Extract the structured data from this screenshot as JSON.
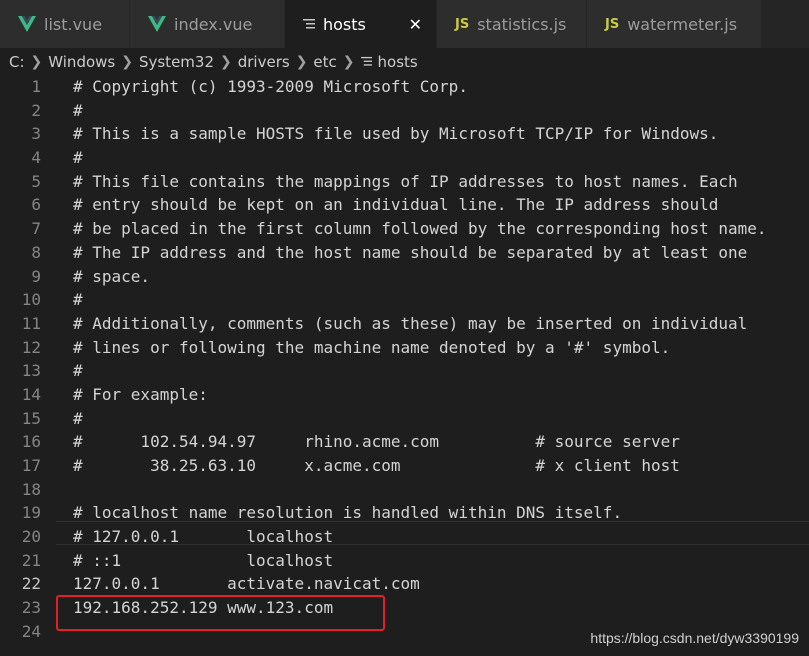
{
  "tabs": [
    {
      "label": "list.vue",
      "icon": "vue-icon"
    },
    {
      "label": "index.vue",
      "icon": "vue-icon"
    },
    {
      "label": "hosts",
      "icon": "file-lines-icon",
      "active": true
    },
    {
      "label": "statistics.js",
      "icon": "js-icon"
    },
    {
      "label": "watermeter.js",
      "icon": "js-icon"
    }
  ],
  "js_badge": "JS",
  "close_glyph": "✕",
  "breadcrumb": {
    "items": [
      "C:",
      "Windows",
      "System32",
      "drivers",
      "etc",
      "hosts"
    ]
  },
  "editor": {
    "lines": [
      {
        "n": "1",
        "text": "# Copyright (c) 1993-2009 Microsoft Corp."
      },
      {
        "n": "2",
        "text": "#"
      },
      {
        "n": "3",
        "text": "# This is a sample HOSTS file used by Microsoft TCP/IP for Windows."
      },
      {
        "n": "4",
        "text": "#"
      },
      {
        "n": "5",
        "text": "# This file contains the mappings of IP addresses to host names. Each"
      },
      {
        "n": "6",
        "text": "# entry should be kept on an individual line. The IP address should"
      },
      {
        "n": "7",
        "text": "# be placed in the first column followed by the corresponding host name."
      },
      {
        "n": "8",
        "text": "# The IP address and the host name should be separated by at least one"
      },
      {
        "n": "9",
        "text": "# space."
      },
      {
        "n": "10",
        "text": "#"
      },
      {
        "n": "11",
        "text": "# Additionally, comments (such as these) may be inserted on individual"
      },
      {
        "n": "12",
        "text": "# lines or following the machine name denoted by a '#' symbol."
      },
      {
        "n": "13",
        "text": "#"
      },
      {
        "n": "14",
        "text": "# For example:"
      },
      {
        "n": "15",
        "text": "#"
      },
      {
        "n": "16",
        "text": "#      102.54.94.97     rhino.acme.com          # source server"
      },
      {
        "n": "17",
        "text": "#       38.25.63.10     x.acme.com              # x client host"
      },
      {
        "n": "18",
        "text": ""
      },
      {
        "n": "19",
        "text": "# localhost name resolution is handled within DNS itself."
      },
      {
        "n": "20",
        "text": "# 127.0.0.1       localhost"
      },
      {
        "n": "21",
        "text": "# ::1             localhost"
      },
      {
        "n": "22",
        "text": "127.0.0.1       activate.navicat.com"
      },
      {
        "n": "23",
        "text": "192.168.252.129 www.123.com"
      },
      {
        "n": "24",
        "text": ""
      }
    ],
    "current_line": "22",
    "highlight_color": "#e3202a"
  },
  "watermark": "https://blog.csdn.net/dyw3390199",
  "colors": {
    "background": "#1e1e1e",
    "tab_inactive": "#2d2d2d",
    "text": "#d4d4d4",
    "line_number": "#858585",
    "js_badge": "#cbcb41",
    "vue_green": "#41b883"
  }
}
